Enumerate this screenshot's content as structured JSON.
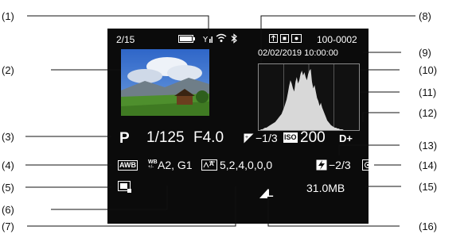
{
  "callouts": {
    "c1": "(1)",
    "c2": "(2)",
    "c3": "(3)",
    "c4": "(4)",
    "c5": "(5)",
    "c6": "(6)",
    "c7": "(7)",
    "c8": "(8)",
    "c9": "(9)",
    "c10": "(10)",
    "c11": "(11)",
    "c12": "(12)",
    "c13": "(13)",
    "c14": "(14)",
    "c15": "(15)",
    "c16": "(16)"
  },
  "screen": {
    "frame_count": "2/15",
    "folder_file": "100-0002",
    "datetime": "02/02/2019  10:00:00",
    "mode": "P",
    "shutter": "1/125",
    "aperture": "F4.0",
    "exposure_comp": "−1/3",
    "iso_label": "ISO",
    "iso_value": "200",
    "d_plus": "D+",
    "wb_badge": "AWB",
    "wb_shift_prefix": "WB",
    "wb_shift": "A2, G1",
    "picture_style_badge": "A",
    "picture_style_values": "5,2,4,0,0,0",
    "flash_comp": "−2/3",
    "file_size": "31.0MB",
    "image_quality": "L"
  },
  "histogram": {
    "levels": [
      0,
      0,
      1,
      1,
      2,
      3,
      3,
      4,
      5,
      6,
      7,
      8,
      9,
      10,
      12,
      14,
      16,
      18,
      20,
      24,
      28,
      33,
      38,
      46,
      55,
      62,
      58,
      52,
      48,
      60,
      66,
      58,
      62,
      70,
      74,
      68,
      72,
      66,
      62,
      70,
      74,
      76,
      60,
      52,
      56,
      48,
      40,
      36,
      30,
      34,
      28,
      24,
      20,
      16,
      12,
      10,
      8,
      6,
      5,
      4,
      3,
      3,
      2,
      2,
      1,
      1,
      1,
      0,
      0,
      0,
      0,
      0,
      0,
      0,
      0,
      0,
      0,
      0,
      0,
      0
    ]
  },
  "icons": {
    "battery": "battery-icon",
    "signal": "signal-icon",
    "wifi": "wifi-icon",
    "bluetooth": "bluetooth-icon",
    "protect": "protect-icon",
    "af_area": "af-area-icon",
    "metering": "metering-icon",
    "lens_correction": "lens-correction-icon"
  }
}
